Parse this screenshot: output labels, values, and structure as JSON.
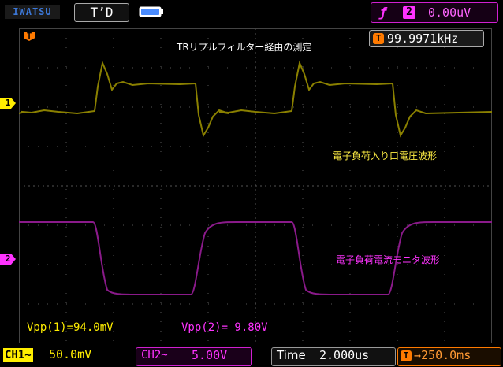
{
  "header": {
    "brand": "IWATSU",
    "mode": "T’D",
    "trigger_symbol": "ƒ",
    "trigger_channel": "2",
    "trigger_level": "0.00uV"
  },
  "screen": {
    "title": "TRリプルフィルター経由の測定",
    "frequency_icon": "T",
    "frequency": "99.9971kHz",
    "trigger_marker": "T",
    "ch1_marker": "1",
    "ch2_marker": "2",
    "ch1_waveform_label": "電子負荷入り口電圧波形",
    "ch2_waveform_label": "電子負荷電流モニタ波形",
    "vpp1": "Vpp(1)=94.0mV",
    "vpp2": "Vpp(2)= 9.80V"
  },
  "footer": {
    "ch1_tag": "CH1~",
    "ch1_scale": "50.0mV",
    "ch2_tag": "CH2~",
    "ch2_scale": "5.00V",
    "time_label": "Time",
    "time_scale": "2.000us",
    "delay_icon": "T",
    "delay": "→250.0ms"
  },
  "colors": {
    "ch1": "#ffee00",
    "ch1_trace": "#8a8000",
    "ch2": "#ff33ff",
    "ch2_trace": "#8a1a8a",
    "trigger": "#ff7a00"
  }
}
